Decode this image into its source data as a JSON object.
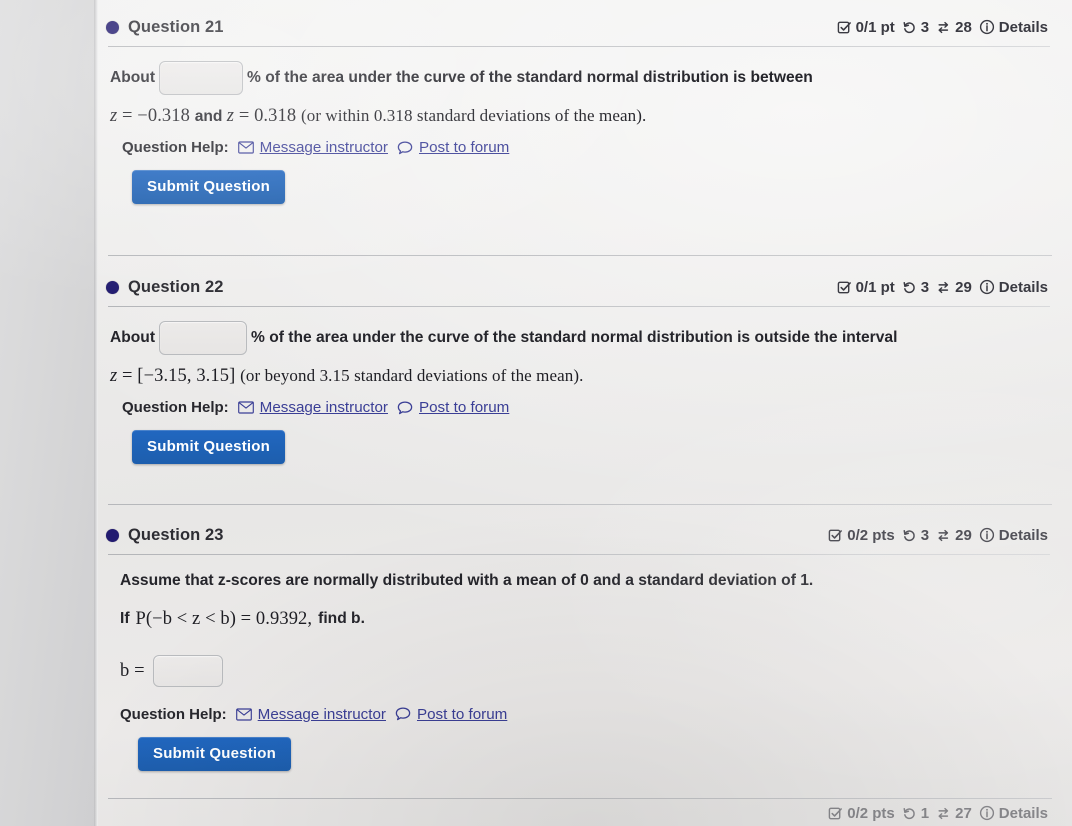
{
  "page": {
    "background_color": "#e8e7e6",
    "accent_blue": "#2167c0",
    "link_color": "#3b3f96",
    "bullet_color": "#221b70"
  },
  "icons": {
    "checkbox": "checkbox-check-icon",
    "attempts": "undo-history-icon",
    "views": "swap-arrows-icon",
    "info": "info-circle-icon",
    "message": "envelope-icon",
    "forum": "speech-bubble-icon"
  },
  "questions": [
    {
      "id": "q21",
      "title": "Question 21",
      "badges": {
        "points": "0/1 pt",
        "attempts": "3",
        "views": "28",
        "details": "Details"
      },
      "body": {
        "prefix": "About",
        "suffix": "% of the area under the curve of the standard normal distribution is between",
        "math_line": "z = −0.318 and z = 0.318 (or within 0.318 standard deviations of the mean).",
        "math_parts": {
          "var1": "z",
          "eq1": "= −0.318",
          "and": "and",
          "var2": "z",
          "eq2": "= 0.318",
          "tail": "(or within 0.318 standard deviations of the mean)."
        },
        "answer_value": ""
      },
      "help": {
        "label": "Question Help:",
        "message": "Message instructor",
        "forum": "Post to forum"
      },
      "submit_label": "Submit Question"
    },
    {
      "id": "q22",
      "title": "Question 22",
      "badges": {
        "points": "0/1 pt",
        "attempts": "3",
        "views": "29",
        "details": "Details"
      },
      "body": {
        "prefix": "About",
        "suffix": "% of the area under the curve of the standard normal distribution is outside the interval",
        "math_line": "z = [−3.15, 3.15] (or beyond 3.15 standard deviations of the mean).",
        "math_parts": {
          "var1": "z",
          "eq1": "= [−3.15, 3.15]",
          "tail": "(or beyond 3.15 standard deviations of the mean)."
        },
        "answer_value": ""
      },
      "help": {
        "label": "Question Help:",
        "message": "Message instructor",
        "forum": "Post to forum"
      },
      "submit_label": "Submit Question"
    },
    {
      "id": "q23",
      "title": "Question 23",
      "badges": {
        "points": "0/2 pts",
        "attempts": "3",
        "views": "29",
        "details": "Details"
      },
      "body": {
        "line1": "Assume that z-scores are normally distributed with a mean of 0 and a standard deviation of 1.",
        "line2_prefix": "If",
        "line2_math": "P(−b < z < b) = 0.9392,",
        "line2_suffix": "find b.",
        "answer_label": "b =",
        "answer_value": ""
      },
      "help": {
        "label": "Question Help:",
        "message": "Message instructor",
        "forum": "Post to forum"
      },
      "submit_label": "Submit Question"
    }
  ],
  "partial_question": {
    "badges": {
      "points": "0/2 pts",
      "attempts": "1",
      "views": "27",
      "details": "Details"
    }
  }
}
